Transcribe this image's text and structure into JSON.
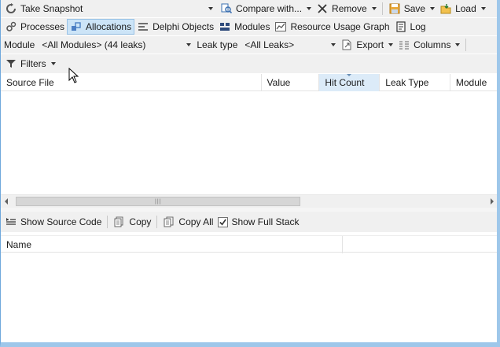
{
  "toolbar1": {
    "take_snapshot": "Take Snapshot",
    "compare_with": "Compare with...",
    "remove": "Remove",
    "save": "Save",
    "load": "Load"
  },
  "tabs": [
    {
      "label": "Processes",
      "icon": "processes-icon"
    },
    {
      "label": "Allocations",
      "icon": "allocations-icon",
      "active": true
    },
    {
      "label": "Delphi Objects",
      "icon": "delphi-objects-icon"
    },
    {
      "label": "Modules",
      "icon": "modules-icon"
    },
    {
      "label": "Resource Usage Graph",
      "icon": "graph-icon"
    },
    {
      "label": "Log",
      "icon": "log-icon"
    }
  ],
  "filters_bar": {
    "module_label": "Module",
    "module_value": "<All Modules> (44 leaks)",
    "leak_type_label": "Leak type",
    "leak_type_value": "<All Leaks>",
    "export": "Export",
    "columns": "Columns",
    "filters": "Filters"
  },
  "allocations_table": {
    "columns": [
      "Source File",
      "Value",
      "Hit Count",
      "Leak Type",
      "Module"
    ],
    "sorted_column": "Hit Count",
    "rows": []
  },
  "stack_toolbar": {
    "show_source_code": "Show Source Code",
    "copy": "Copy",
    "copy_all": "Copy All",
    "show_full_stack": "Show Full Stack",
    "show_full_stack_checked": true
  },
  "stack_table": {
    "columns": [
      "Name"
    ],
    "rows": []
  },
  "colors": {
    "toolbar_bg": "#f0f0f0",
    "active_tab_bg": "#cce4f7",
    "active_tab_border": "#98c2e6",
    "sorted_column_bg": "#dcebf8",
    "window_border": "#9ec7ea"
  }
}
